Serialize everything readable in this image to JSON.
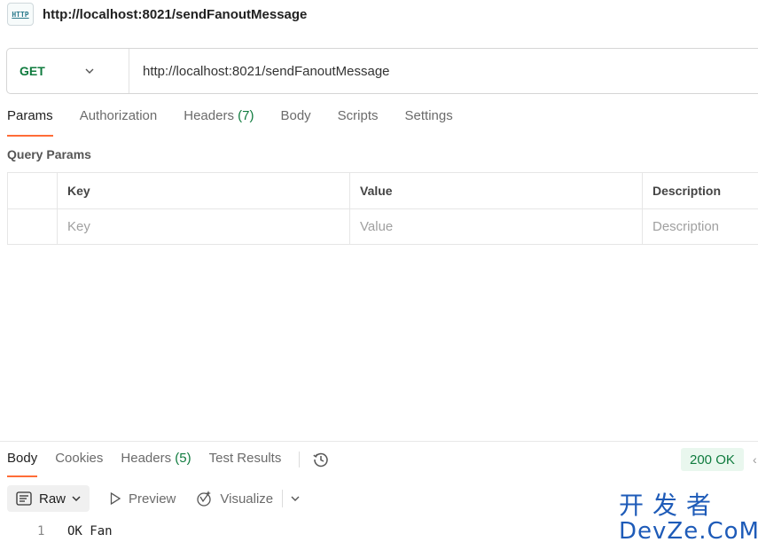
{
  "request": {
    "title": "http://localhost:8021/sendFanoutMessage",
    "icon_text": "HTTP",
    "method": "GET",
    "url": "http://localhost:8021/sendFanoutMessage"
  },
  "request_tabs": [
    {
      "label": "Params",
      "active": true
    },
    {
      "label": "Authorization"
    },
    {
      "label": "Headers",
      "count": "(7)"
    },
    {
      "label": "Body"
    },
    {
      "label": "Scripts"
    },
    {
      "label": "Settings"
    }
  ],
  "params": {
    "section_label": "Query Params",
    "columns": [
      "Key",
      "Value",
      "Description"
    ],
    "placeholders": [
      "Key",
      "Value",
      "Description"
    ]
  },
  "response_tabs": [
    {
      "label": "Body",
      "active": true
    },
    {
      "label": "Cookies"
    },
    {
      "label": "Headers",
      "count": "(5)"
    },
    {
      "label": "Test Results"
    }
  ],
  "response": {
    "status": "200 OK",
    "view_mode": "Raw",
    "preview_label": "Preview",
    "visualize_label": "Visualize",
    "lines": [
      {
        "no": "1",
        "text": "OK Fan"
      }
    ]
  },
  "watermark": {
    "cn": "开发者",
    "en": "DevZe.CoM"
  },
  "colors": {
    "accent": "#ff6c37",
    "method_get": "#0f7b3e",
    "status_ok_bg": "#e9f7ee",
    "watermark": "#1e5bb8"
  }
}
